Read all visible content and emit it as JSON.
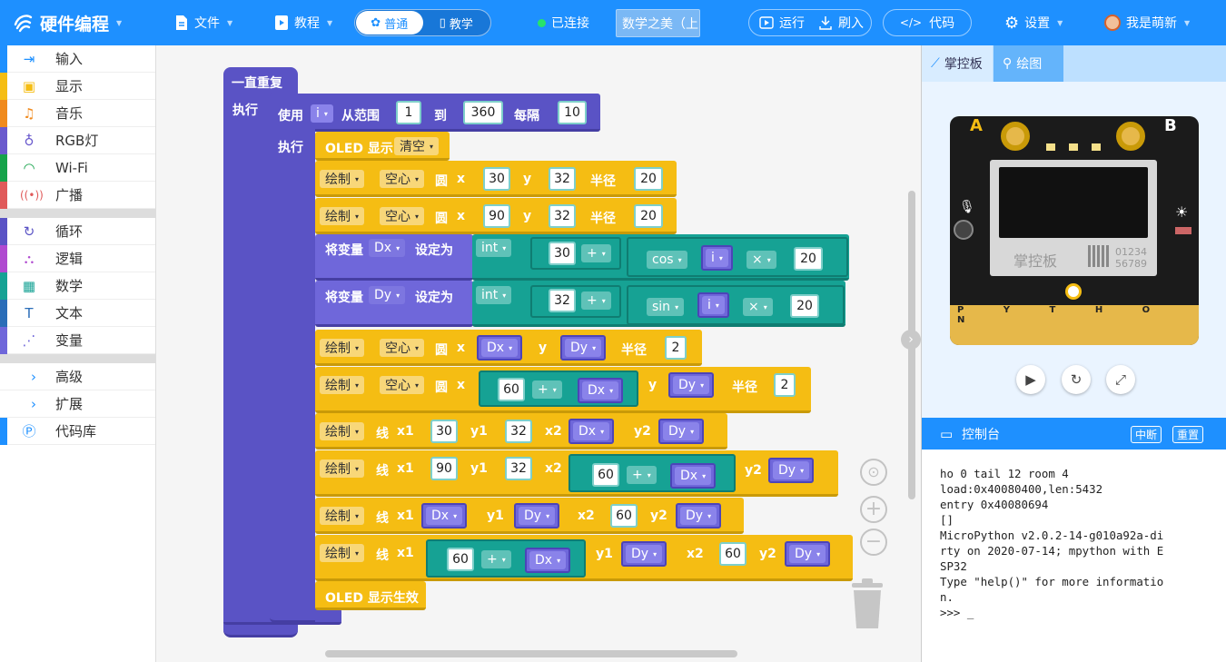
{
  "header": {
    "brand": "硬件编程",
    "file": "文件",
    "tutorial": "教程",
    "mode_normal": "普通",
    "mode_teach": "教学",
    "status": "已连接",
    "device": "数学之美（上",
    "run": "运行",
    "flash": "刷入",
    "code": "代码",
    "settings": "设置",
    "user": "我是萌新"
  },
  "sidebar": {
    "items": [
      {
        "label": "输入",
        "color": "#1e90ff"
      },
      {
        "label": "显示",
        "color": "#f5bd13"
      },
      {
        "label": "音乐",
        "color": "#f08a1d"
      },
      {
        "label": "RGB灯",
        "color": "#6a5acd"
      },
      {
        "label": "Wi-Fi",
        "color": "#16a34a"
      },
      {
        "label": "广播",
        "color": "#e05a5a"
      },
      {
        "label": "循环",
        "color": "#5a53c5"
      },
      {
        "label": "逻辑",
        "color": "#b04ad0"
      },
      {
        "label": "数学",
        "color": "#16a294"
      },
      {
        "label": "文本",
        "color": "#2a6db8"
      },
      {
        "label": "变量",
        "color": "#6f67da"
      },
      {
        "label": "高级",
        "color": "#1e90ff"
      },
      {
        "label": "扩展",
        "color": "#1e90ff"
      },
      {
        "label": "代码库",
        "color": "#1e90ff"
      }
    ]
  },
  "blocks": {
    "forever": "一直重复",
    "do": "执行",
    "use": "使用",
    "loop_var": "i",
    "from_range": "从范围",
    "from": "1",
    "to_label": "到",
    "to": "360",
    "step_label": "每隔",
    "step": "10",
    "oled_show": "OLED 显示",
    "clear": "清空",
    "draw": "绘制",
    "hollow": "空心",
    "circle": "圆",
    "x": "x",
    "y": "y",
    "radius": "半径",
    "set_var": "将变量",
    "set_to": "设定为",
    "int": "int",
    "plus": "+",
    "times": "×",
    "cos": "cos",
    "sin": "sin",
    "var_dx": "Dx",
    "var_dy": "Dy",
    "n30": "30",
    "n32": "32",
    "n20": "20",
    "n90": "90",
    "n2": "2",
    "n60": "60",
    "line": "线",
    "x1": "x1",
    "y1": "y1",
    "x2": "x2",
    "y2": "y2",
    "oled_apply": "OLED 显示生效"
  },
  "panel": {
    "tab_board": "掌控板",
    "tab_draw": "绘图",
    "btn_a": "A",
    "btn_b": "B",
    "screen_logo": "掌控板",
    "screen_num1": "01234",
    "screen_num2": "56789",
    "pins": "P  Y  T  H  O  N",
    "console_title": "控制台",
    "interrupt": "中断",
    "reset": "重置",
    "console_lines": [
      "ho 0 tail 12 room 4",
      "load:0x40080400,len:5432",
      "entry 0x40080694",
      "[]",
      "MicroPython v2.0.2-14-g010a92a-di",
      "rty on 2020-07-14; mpython with E",
      "SP32",
      "Type \"help()\" for more informatio",
      "n.",
      ">>> _"
    ]
  }
}
